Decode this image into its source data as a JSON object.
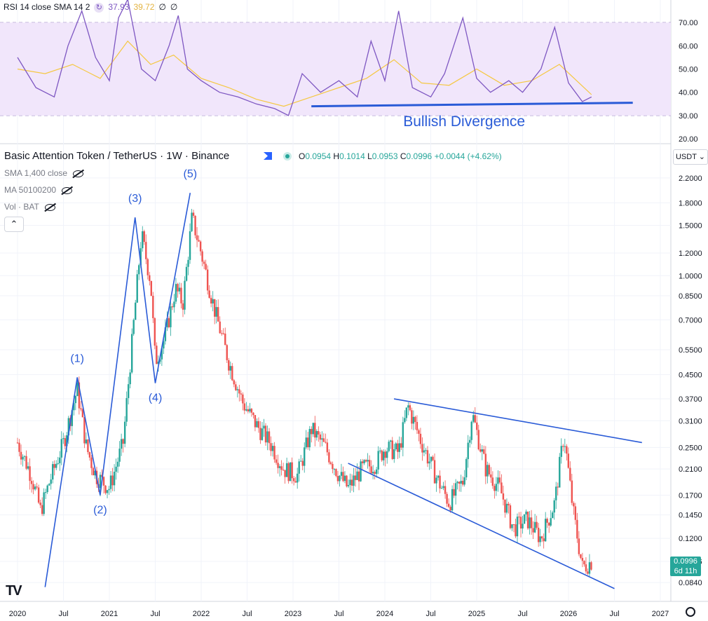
{
  "rsi_panel": {
    "legend_name": "RSI 14 close SMA 14 2",
    "value_rsi": "37.93",
    "value_sma": "39.72",
    "value_3": "∅",
    "value_4": "∅",
    "annotation": "Bullish Divergence",
    "band_color": "#f1e6fb",
    "rsi_color": "#7e57c2",
    "sma_color": "#f5c842"
  },
  "main_panel": {
    "title": "Basic Attention Token / TetherUS · 1W · Binance",
    "ohlc": {
      "o_label": "O",
      "o": "0.0954",
      "h_label": "H",
      "h": "0.1014",
      "l_label": "L",
      "l": "0.0953",
      "c_label": "C",
      "c": "0.0996",
      "change": "+0.0044 (+4.62%)"
    },
    "indicators": [
      "SMA 1,400 close",
      "MA 50100200",
      "Vol · BAT"
    ],
    "currency_button": "USDT ⌄",
    "collapse_symbol": "⌃",
    "last_price": "0.0996",
    "countdown": "6d 11h",
    "logo": "TV",
    "up_color": "#26a69a",
    "down_color": "#ef5350",
    "line_color": "#2a5bd7"
  },
  "chart_data": [
    {
      "type": "line",
      "title": "",
      "yticks": [
        "70.00",
        "60.00",
        "50.00",
        "40.00",
        "30.00",
        "20.00"
      ],
      "ylim": [
        20,
        80
      ],
      "band": [
        30,
        70
      ],
      "series": [
        {
          "name": "RSI 14",
          "x": [
            2020.0,
            2020.2,
            2020.4,
            2020.55,
            2020.7,
            2020.85,
            2021.0,
            2021.1,
            2021.2,
            2021.35,
            2021.5,
            2021.65,
            2021.75,
            2021.85,
            2022.0,
            2022.2,
            2022.4,
            2022.6,
            2022.8,
            2022.95,
            2023.1,
            2023.3,
            2023.5,
            2023.7,
            2023.85,
            2024.0,
            2024.15,
            2024.3,
            2024.5,
            2024.65,
            2024.85,
            2025.0,
            2025.15,
            2025.35,
            2025.5,
            2025.7,
            2025.85,
            2026.0,
            2026.15,
            2026.25
          ],
          "values": [
            55,
            42,
            38,
            60,
            75,
            55,
            45,
            72,
            80,
            50,
            45,
            60,
            73,
            50,
            45,
            40,
            38,
            35,
            33,
            30,
            48,
            40,
            45,
            38,
            62,
            45,
            75,
            42,
            38,
            48,
            72,
            46,
            40,
            45,
            40,
            50,
            68,
            44,
            36,
            38
          ]
        },
        {
          "name": "SMA",
          "x": [
            2020.0,
            2020.3,
            2020.6,
            2020.9,
            2021.2,
            2021.45,
            2021.7,
            2022.0,
            2022.3,
            2022.6,
            2022.9,
            2023.2,
            2023.5,
            2023.8,
            2024.1,
            2024.4,
            2024.7,
            2025.0,
            2025.3,
            2025.6,
            2025.9,
            2026.25
          ],
          "values": [
            50,
            48,
            52,
            46,
            62,
            52,
            56,
            46,
            42,
            37,
            34,
            38,
            42,
            46,
            54,
            44,
            43,
            50,
            43,
            45,
            52,
            39
          ]
        }
      ],
      "annotations": [
        "Bullish Divergence"
      ]
    },
    {
      "type": "candlestick",
      "title": "Basic Attention Token / TetherUS · 1W · Binance",
      "scale": "log",
      "xticks": [
        "2020",
        "Jul",
        "2021",
        "Jul",
        "2022",
        "Jul",
        "2023",
        "Jul",
        "2024",
        "Jul",
        "2025",
        "Jul",
        "2026",
        "Jul",
        "2027"
      ],
      "yticks": [
        "2.2000",
        "1.8000",
        "1.5000",
        "1.2000",
        "1.0000",
        "0.8500",
        "0.7000",
        "0.5500",
        "0.4500",
        "0.3700",
        "0.3100",
        "0.2500",
        "0.2100",
        "0.1700",
        "0.1450",
        "0.1200",
        "0.0996",
        "0.0840"
      ],
      "price_path": {
        "x": [
          2020.0,
          2020.15,
          2020.25,
          2020.35,
          2020.5,
          2020.65,
          2020.75,
          2020.85,
          2021.0,
          2021.15,
          2021.25,
          2021.35,
          2021.45,
          2021.5,
          2021.6,
          2021.72,
          2021.8,
          2021.9,
          2022.0,
          2022.15,
          2022.3,
          2022.45,
          2022.6,
          2022.75,
          2022.9,
          2023.05,
          2023.2,
          2023.35,
          2023.5,
          2023.6,
          2023.75,
          2023.9,
          2024.0,
          2024.15,
          2024.25,
          2024.4,
          2024.55,
          2024.7,
          2024.85,
          2024.95,
          2025.1,
          2025.25,
          2025.4,
          2025.55,
          2025.7,
          2025.85,
          2025.95,
          2026.05,
          2026.15,
          2026.25
        ],
        "values": [
          0.26,
          0.2,
          0.15,
          0.19,
          0.26,
          0.4,
          0.25,
          0.2,
          0.18,
          0.26,
          0.6,
          1.4,
          0.95,
          0.5,
          0.6,
          0.9,
          0.8,
          1.6,
          1.2,
          0.75,
          0.5,
          0.36,
          0.3,
          0.26,
          0.21,
          0.2,
          0.29,
          0.25,
          0.2,
          0.18,
          0.21,
          0.22,
          0.25,
          0.24,
          0.35,
          0.26,
          0.2,
          0.16,
          0.19,
          0.33,
          0.21,
          0.18,
          0.13,
          0.14,
          0.12,
          0.16,
          0.28,
          0.15,
          0.095,
          0.0996
        ]
      },
      "elliott_wave": {
        "labels": [
          "(1)",
          "(2)",
          "(3)",
          "(4)",
          "(5)"
        ],
        "x": [
          2020.3,
          2020.65,
          2020.9,
          2021.28,
          2021.5,
          2021.88
        ],
        "values": [
          0.081,
          0.44,
          0.17,
          1.6,
          0.42,
          1.95
        ]
      },
      "trendlines": [
        {
          "name": "upper",
          "x": [
            2024.1,
            2026.8
          ],
          "values": [
            0.37,
            0.26
          ]
        },
        {
          "name": "lower",
          "x": [
            2023.6,
            2026.5
          ],
          "values": [
            0.22,
            0.08
          ]
        }
      ]
    }
  ]
}
